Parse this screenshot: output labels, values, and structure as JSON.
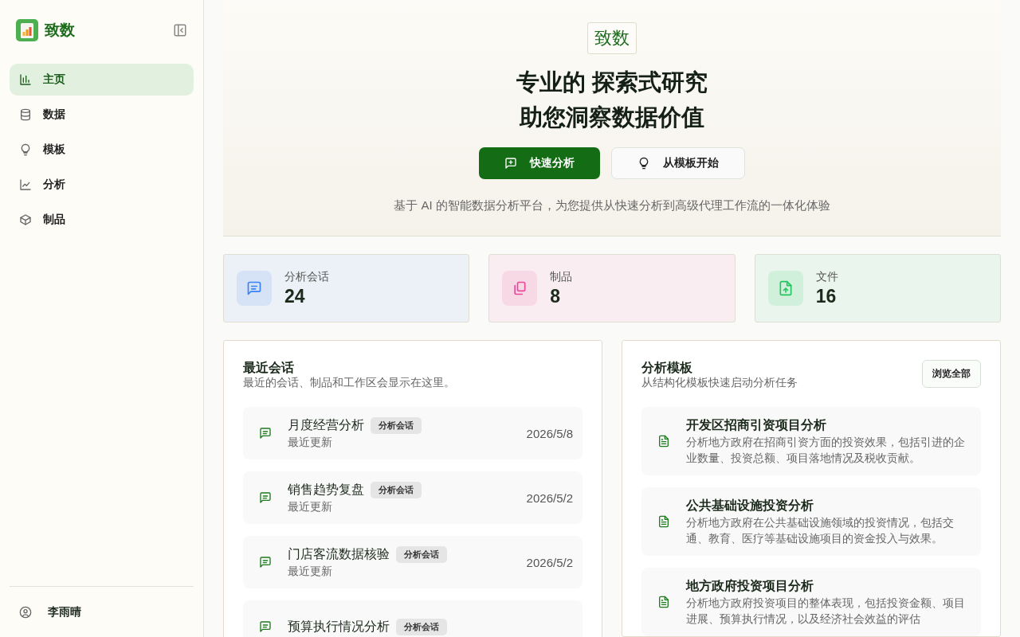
{
  "sidebar": {
    "brand": "致数",
    "nav": [
      {
        "label": "主页",
        "selected": true
      },
      {
        "label": "数据",
        "selected": false
      },
      {
        "label": "模板",
        "selected": false
      },
      {
        "label": "分析",
        "selected": false
      },
      {
        "label": "制品",
        "selected": false
      }
    ],
    "user": "李雨晴"
  },
  "hero": {
    "badge": "致数",
    "title_lines": [
      "专业的 探索式研究",
      "助您洞察数据价值"
    ],
    "buttons": [
      {
        "label": "快速分析",
        "kind": "primary"
      },
      {
        "label": "从模板开始",
        "kind": "secondary"
      }
    ],
    "subtitle": "基于 AI 的智能数据分析平台，为您提供从快速分析到高级代理工作流的一体化体验"
  },
  "stats": [
    {
      "label": "分析会话",
      "value": "24",
      "color": "#3b82f6"
    },
    {
      "label": "制品",
      "value": "8",
      "color": "#ec4899"
    },
    {
      "label": "文件",
      "value": "16",
      "color": "#22c55e"
    }
  ],
  "recent": {
    "title": "最近会话",
    "subtitle": "最近的会话、制品和工作区会显示在这里。",
    "items": [
      {
        "title": "月度经营分析",
        "tag": "分析会话",
        "note": "最近更新",
        "date": "2026/5/8"
      },
      {
        "title": "销售趋势复盘",
        "tag": "分析会话",
        "note": "最近更新",
        "date": "2026/5/2"
      },
      {
        "title": "门店客流数据核验",
        "tag": "分析会话",
        "note": "最近更新",
        "date": "2026/5/2"
      },
      {
        "title": "预算执行情况分析",
        "tag": "分析会话"
      }
    ]
  },
  "templates": {
    "title": "分析模板",
    "subtitle": "从结构化模板快速启动分析任务",
    "action": "浏览全部",
    "items": [
      {
        "title": "开发区招商引资项目分析",
        "description": "分析地方政府在招商引资方面的投资效果，包括引进的企业数量、投资总额、项目落地情况及税收贡献。"
      },
      {
        "title": "公共基础设施投资分析",
        "description": "分析地方政府在公共基础设施领域的投资情况，包括交通、教育、医疗等基础设施项目的资金投入与效果。"
      },
      {
        "title": "地方政府投资项目分析",
        "description": "分析地方政府投资项目的整体表现，包括投资金额、项目进展、预算执行情况，以及经济社会效益的评估"
      }
    ]
  }
}
